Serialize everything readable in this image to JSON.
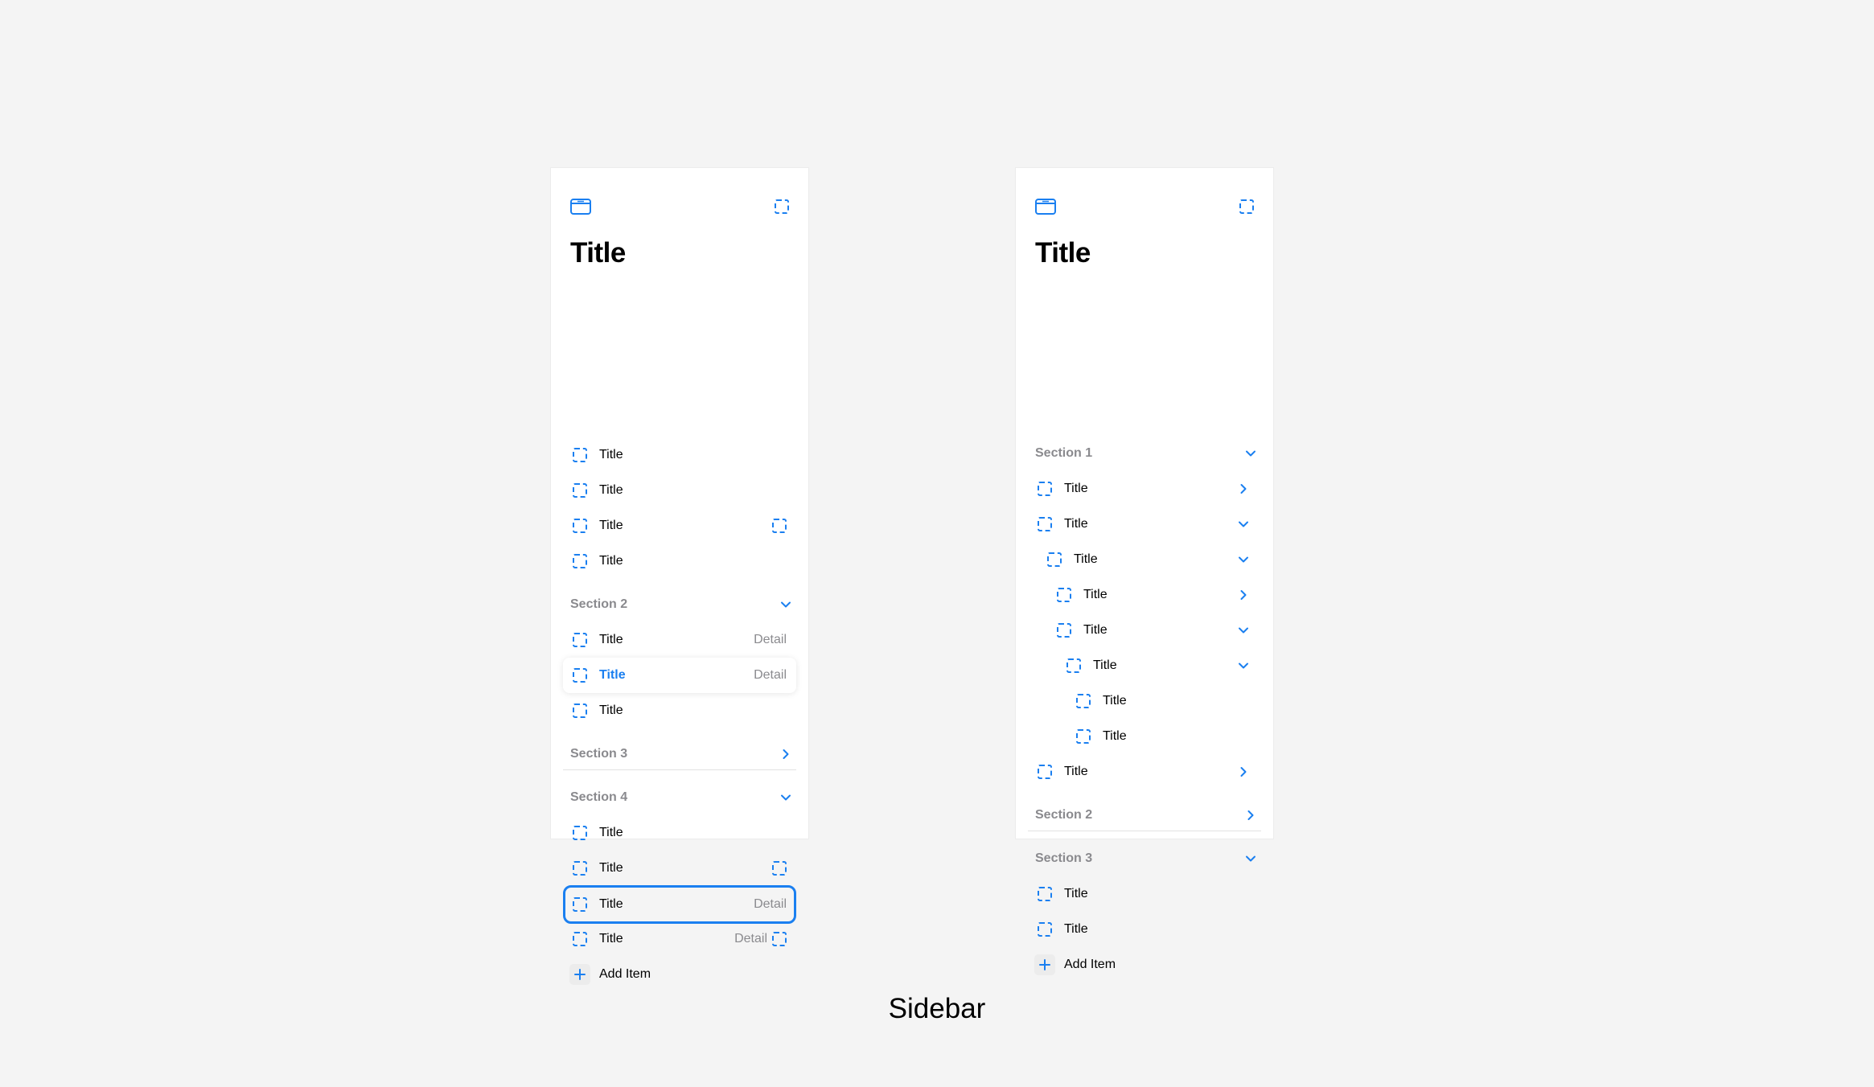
{
  "caption": "Sidebar",
  "accent_color": "#1a7ff0",
  "left_panel": {
    "title": "Title",
    "top_items": [
      {
        "label": "Title"
      },
      {
        "label": "Title"
      },
      {
        "label": "Title",
        "trailing_icon": "placeholder-icon"
      },
      {
        "label": "Title"
      }
    ],
    "section2": {
      "label": "Section 2",
      "chevron": "chevron-down-icon",
      "items": [
        {
          "label": "Title",
          "detail": "Detail"
        },
        {
          "label": "Title",
          "detail": "Detail",
          "state": "selected"
        },
        {
          "label": "Title"
        }
      ]
    },
    "section3": {
      "label": "Section 3",
      "chevron": "chevron-right-icon"
    },
    "section4": {
      "label": "Section 4",
      "chevron": "chevron-down-icon",
      "items": [
        {
          "label": "Title"
        },
        {
          "label": "Title",
          "trailing_icon": "placeholder-icon"
        },
        {
          "label": "Title",
          "detail": "Detail",
          "state": "focused"
        },
        {
          "label": "Title",
          "detail": "Detail",
          "trailing_icon": "placeholder-icon"
        }
      ]
    },
    "add_item": "Add Item"
  },
  "right_panel": {
    "title": "Title",
    "section1": {
      "label": "Section 1",
      "chevron": "chevron-down-icon",
      "items": [
        {
          "label": "Title",
          "chevron": "chevron-right-icon"
        },
        {
          "label": "Title",
          "chevron": "chevron-down-icon"
        },
        {
          "label": "Title",
          "chevron": "chevron-down-icon"
        },
        {
          "label": "Title",
          "chevron": "chevron-right-icon"
        },
        {
          "label": "Title",
          "chevron": "chevron-down-icon"
        },
        {
          "label": "Title",
          "chevron": "chevron-down-icon"
        },
        {
          "label": "Title"
        },
        {
          "label": "Title"
        },
        {
          "label": "Title",
          "chevron": "chevron-right-icon"
        }
      ]
    },
    "section2": {
      "label": "Section 2",
      "chevron": "chevron-right-icon"
    },
    "section3": {
      "label": "Section 3",
      "chevron": "chevron-down-icon",
      "items": [
        {
          "label": "Title"
        },
        {
          "label": "Title"
        }
      ]
    },
    "add_item": "Add Item"
  }
}
